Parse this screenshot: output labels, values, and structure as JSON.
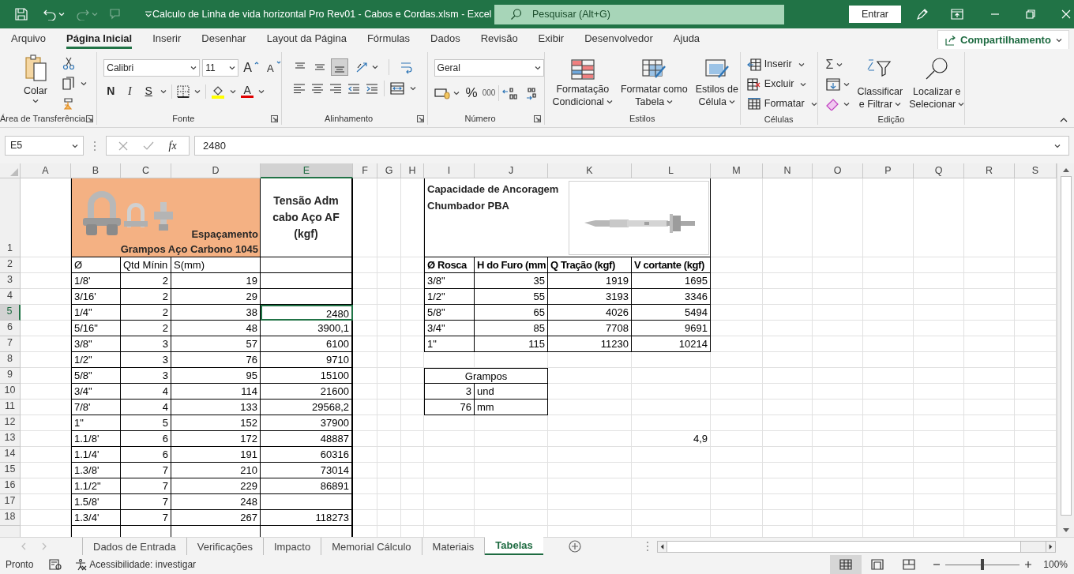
{
  "title_bar": {
    "title": "Calculo de Linha de vida horizontal  Pro Rev01 - Cabos e Cordas.xlsm  -  Excel",
    "search_placeholder": "Pesquisar (Alt+G)",
    "sign_in": "Entrar",
    "redo_disabled": true,
    "touch_disabled": true
  },
  "ribbon_tabs": [
    {
      "label": "Arquivo",
      "selected": false
    },
    {
      "label": "Página Inicial",
      "selected": true
    },
    {
      "label": "Inserir",
      "selected": false
    },
    {
      "label": "Desenhar",
      "selected": false
    },
    {
      "label": "Layout da Página",
      "selected": false
    },
    {
      "label": "Fórmulas",
      "selected": false
    },
    {
      "label": "Dados",
      "selected": false
    },
    {
      "label": "Revisão",
      "selected": false
    },
    {
      "label": "Exibir",
      "selected": false
    },
    {
      "label": "Desenvolvedor",
      "selected": false
    },
    {
      "label": "Ajuda",
      "selected": false
    }
  ],
  "share_button": "Compartilhamento",
  "ribbon": {
    "clipboard": {
      "paste": "Colar",
      "label": "Área de Transferência"
    },
    "font": {
      "name": "Calibri",
      "size": "11",
      "grow": "A",
      "shrink": "A",
      "bold": "N",
      "italic": "I",
      "underline": "S",
      "font_color_label": "A",
      "label": "Fonte"
    },
    "alignment": {
      "label": "Alinhamento",
      "vertical": [
        {
          "selected": false
        },
        {
          "selected": false
        },
        {
          "selected": true
        }
      ]
    },
    "number": {
      "format": "Geral",
      "percent": "%",
      "thousands": "000",
      "label": "Número"
    },
    "styles": {
      "label": "Estilos",
      "buttons": [
        {
          "lines": [
            "Formatação",
            "Condicional"
          ]
        },
        {
          "lines": [
            "Formatar como",
            "Tabela"
          ]
        },
        {
          "lines": [
            "Estilos de",
            "Célula"
          ]
        }
      ]
    },
    "cells": {
      "label": "Células",
      "buttons": [
        "Inserir",
        "Excluir",
        "Formatar"
      ]
    },
    "editing": {
      "label": "Edição",
      "autosum": "Σ",
      "buttons": [
        {
          "lines": [
            "Classificar",
            "e Filtrar"
          ]
        },
        {
          "lines": [
            "Localizar e",
            "Selecionar"
          ]
        }
      ]
    }
  },
  "formula_bar": {
    "name_box": "E5",
    "function_label": "fx",
    "value": "2480"
  },
  "sheet": {
    "columns": [
      {
        "label": "A",
        "selected": false
      },
      {
        "label": "B",
        "selected": false
      },
      {
        "label": "C",
        "selected": false
      },
      {
        "label": "D",
        "selected": false
      },
      {
        "label": "E",
        "selected": true
      },
      {
        "label": "F",
        "selected": false
      },
      {
        "label": "G",
        "selected": false
      },
      {
        "label": "H",
        "selected": false
      },
      {
        "label": "I",
        "selected": false
      },
      {
        "label": "J",
        "selected": false
      },
      {
        "label": "K",
        "selected": false
      },
      {
        "label": "L",
        "selected": false
      },
      {
        "label": "M",
        "selected": false
      },
      {
        "label": "N",
        "selected": false
      },
      {
        "label": "O",
        "selected": false
      },
      {
        "label": "P",
        "selected": false
      },
      {
        "label": "Q",
        "selected": false
      },
      {
        "label": "R",
        "selected": false
      },
      {
        "label": "S",
        "selected": false
      }
    ],
    "row_numbers": [
      {
        "label": "1",
        "selected": false
      },
      {
        "label": "2",
        "selected": false
      },
      {
        "label": "3",
        "selected": false
      },
      {
        "label": "4",
        "selected": false
      },
      {
        "label": "5",
        "selected": true
      },
      {
        "label": "6",
        "selected": false
      },
      {
        "label": "7",
        "selected": false
      },
      {
        "label": "8",
        "selected": false
      },
      {
        "label": "9",
        "selected": false
      },
      {
        "label": "10",
        "selected": false
      },
      {
        "label": "11",
        "selected": false
      },
      {
        "label": "12",
        "selected": false
      },
      {
        "label": "13",
        "selected": false
      },
      {
        "label": "14",
        "selected": false
      },
      {
        "label": "15",
        "selected": false
      },
      {
        "label": "16",
        "selected": false
      },
      {
        "label": "17",
        "selected": false
      },
      {
        "label": "18",
        "selected": false
      }
    ],
    "clamp_table": {
      "title_lines": [
        "Espaçamento",
        "Grampos Aço Carbono 1045"
      ],
      "tension_header": "Tensão Adm cabo Aço AF (kgf)",
      "columns": [
        "Ø",
        "Qtd Mínin",
        "S(mm)"
      ],
      "rows": [
        {
          "diameter": "1/8'",
          "quantity": "2",
          "spacing": "19",
          "selected": false
        },
        {
          "diameter": "3/16'",
          "quantity": "2",
          "spacing": "29",
          "selected": false
        },
        {
          "diameter": "1/4\"",
          "quantity": "2",
          "spacing": "38",
          "tension": "2480",
          "selected": true
        },
        {
          "diameter": "5/16\"",
          "quantity": "2",
          "spacing": "48",
          "tension": "3900,1",
          "selected": false
        },
        {
          "diameter": "3/8\"",
          "quantity": "3",
          "spacing": "57",
          "tension": "6100",
          "selected": false
        },
        {
          "diameter": "1/2\"",
          "quantity": "3",
          "spacing": "76",
          "tension": "9710",
          "selected": false
        },
        {
          "diameter": "5/8\"",
          "quantity": "3",
          "spacing": "95",
          "tension": "15100",
          "selected": false
        },
        {
          "diameter": "3/4\"",
          "quantity": "4",
          "spacing": "114",
          "tension": "21600",
          "selected": false
        },
        {
          "diameter": "7/8'",
          "quantity": "4",
          "spacing": "133",
          "tension": "29568,2",
          "selected": false
        },
        {
          "diameter": "1\"",
          "quantity": "5",
          "spacing": "152",
          "tension": "37900",
          "selected": false
        },
        {
          "diameter": "1.1/8'",
          "quantity": "6",
          "spacing": "172",
          "tension": "48887",
          "selected": false
        },
        {
          "diameter": "1.1/4'",
          "quantity": "6",
          "spacing": "191",
          "tension": "60316",
          "selected": false
        },
        {
          "diameter": "1.3/8'",
          "quantity": "7",
          "spacing": "210",
          "tension": "73014",
          "selected": false
        },
        {
          "diameter": "1.1/2\"",
          "quantity": "7",
          "spacing": "229",
          "tension": "86891",
          "selected": false
        },
        {
          "diameter": "1.5/8'",
          "quantity": "7",
          "spacing": "248",
          "selected": false
        },
        {
          "diameter": "1.3/4'",
          "quantity": "7",
          "spacing": "267",
          "tension": "118273",
          "selected": false
        }
      ]
    },
    "anchor_table": {
      "title_lines": [
        "Capacidade de Ancoragem",
        "Chumbador PBA"
      ],
      "columns": [
        "Ø Rosca",
        "H do Furo (mm",
        "Q Tração (kgf)",
        "V cortante (kgf)"
      ],
      "rows": [
        [
          "3/8\"",
          "35",
          "1919",
          "1695"
        ],
        [
          "1/2\"",
          "55",
          "3193",
          "3346"
        ],
        [
          "5/8\"",
          "65",
          "4026",
          "5494"
        ],
        [
          "3/4\"",
          "85",
          "7708",
          "9691"
        ],
        [
          "1\"",
          "115",
          "11230",
          "10214"
        ]
      ]
    },
    "clamps_box": {
      "title": "Grampos",
      "rows": [
        {
          "value": "3",
          "unit": "und"
        },
        {
          "value": "76",
          "unit": "mm"
        }
      ]
    },
    "loose_value": "4,9"
  },
  "sheet_tabs": [
    {
      "label": "Dados de Entrada",
      "selected": false
    },
    {
      "label": "Verificações",
      "selected": false
    },
    {
      "label": "Impacto",
      "selected": false
    },
    {
      "label": "Memorial Cálculo",
      "selected": false
    },
    {
      "label": "Materiais",
      "selected": false
    },
    {
      "label": "Tabelas",
      "selected": true
    }
  ],
  "status_bar": {
    "status": "Pronto",
    "accessibility": "Acessibilidade: investigar",
    "views": [
      {
        "selected": true
      },
      {
        "selected": false
      },
      {
        "selected": false
      }
    ],
    "zoom": {
      "level": 0.5,
      "label": "100%"
    }
  }
}
